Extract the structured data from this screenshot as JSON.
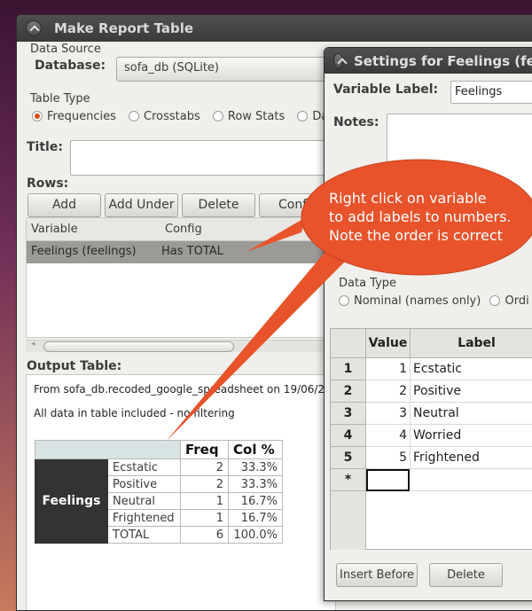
{
  "main_window": {
    "title": "Make Report Table",
    "data_source_label": "Data Source",
    "database_label": "Database:",
    "database_value": "sofa_db (SQLite)",
    "table_type_label": "Table Type",
    "table_types": [
      "Frequencies",
      "Crosstabs",
      "Row Stats",
      "Data"
    ],
    "title_label": "Title:",
    "rows_label": "Rows:",
    "row_buttons": [
      "Add",
      "Add Under",
      "Delete",
      "Config"
    ],
    "rows_columns": [
      "Variable",
      "Config"
    ],
    "rows_items": [
      {
        "variable": "Feelings (feelings)",
        "config": "Has TOTAL"
      }
    ],
    "output_label": "Output Table:",
    "output_source": "From sofa_db.recoded_google_spreadsheet on 19/06/2",
    "output_filter": "All data in table included - no filtering",
    "output_table": {
      "var_name": "Feelings",
      "col_freq": "Freq",
      "col_pct": "Col %",
      "rows": [
        {
          "label": "Ecstatic",
          "freq": "2",
          "pct": "33.3%"
        },
        {
          "label": "Positive",
          "freq": "2",
          "pct": "33.3%"
        },
        {
          "label": "Neutral",
          "freq": "1",
          "pct": "16.7%"
        },
        {
          "label": "Frightened",
          "freq": "1",
          "pct": "16.7%"
        },
        {
          "label": "TOTAL",
          "freq": "6",
          "pct": "100.0%"
        }
      ]
    }
  },
  "settings_dialog": {
    "title": "Settings for Feelings (fee",
    "var_label_label": "Variable Label:",
    "var_label_value": "Feelings",
    "notes_label": "Notes:",
    "data_type_label": "Data Type",
    "data_types": [
      "Nominal (names only)",
      "Ordi"
    ],
    "grid_header_value": "Value",
    "grid_header_label": "Label",
    "grid_rows": [
      {
        "num": "1",
        "value": "1",
        "label": "Ecstatic"
      },
      {
        "num": "2",
        "value": "2",
        "label": "Positive"
      },
      {
        "num": "3",
        "value": "3",
        "label": "Neutral"
      },
      {
        "num": "4",
        "value": "4",
        "label": "Worried"
      },
      {
        "num": "5",
        "value": "5",
        "label": "Frightened"
      }
    ],
    "new_row_marker": "*",
    "insert_before": "Insert Before",
    "delete": "Delete"
  },
  "callout": {
    "lines": [
      "Right click on variable",
      "to add labels to numbers.",
      "Note the order is correct"
    ],
    "color": "#e8532c"
  }
}
